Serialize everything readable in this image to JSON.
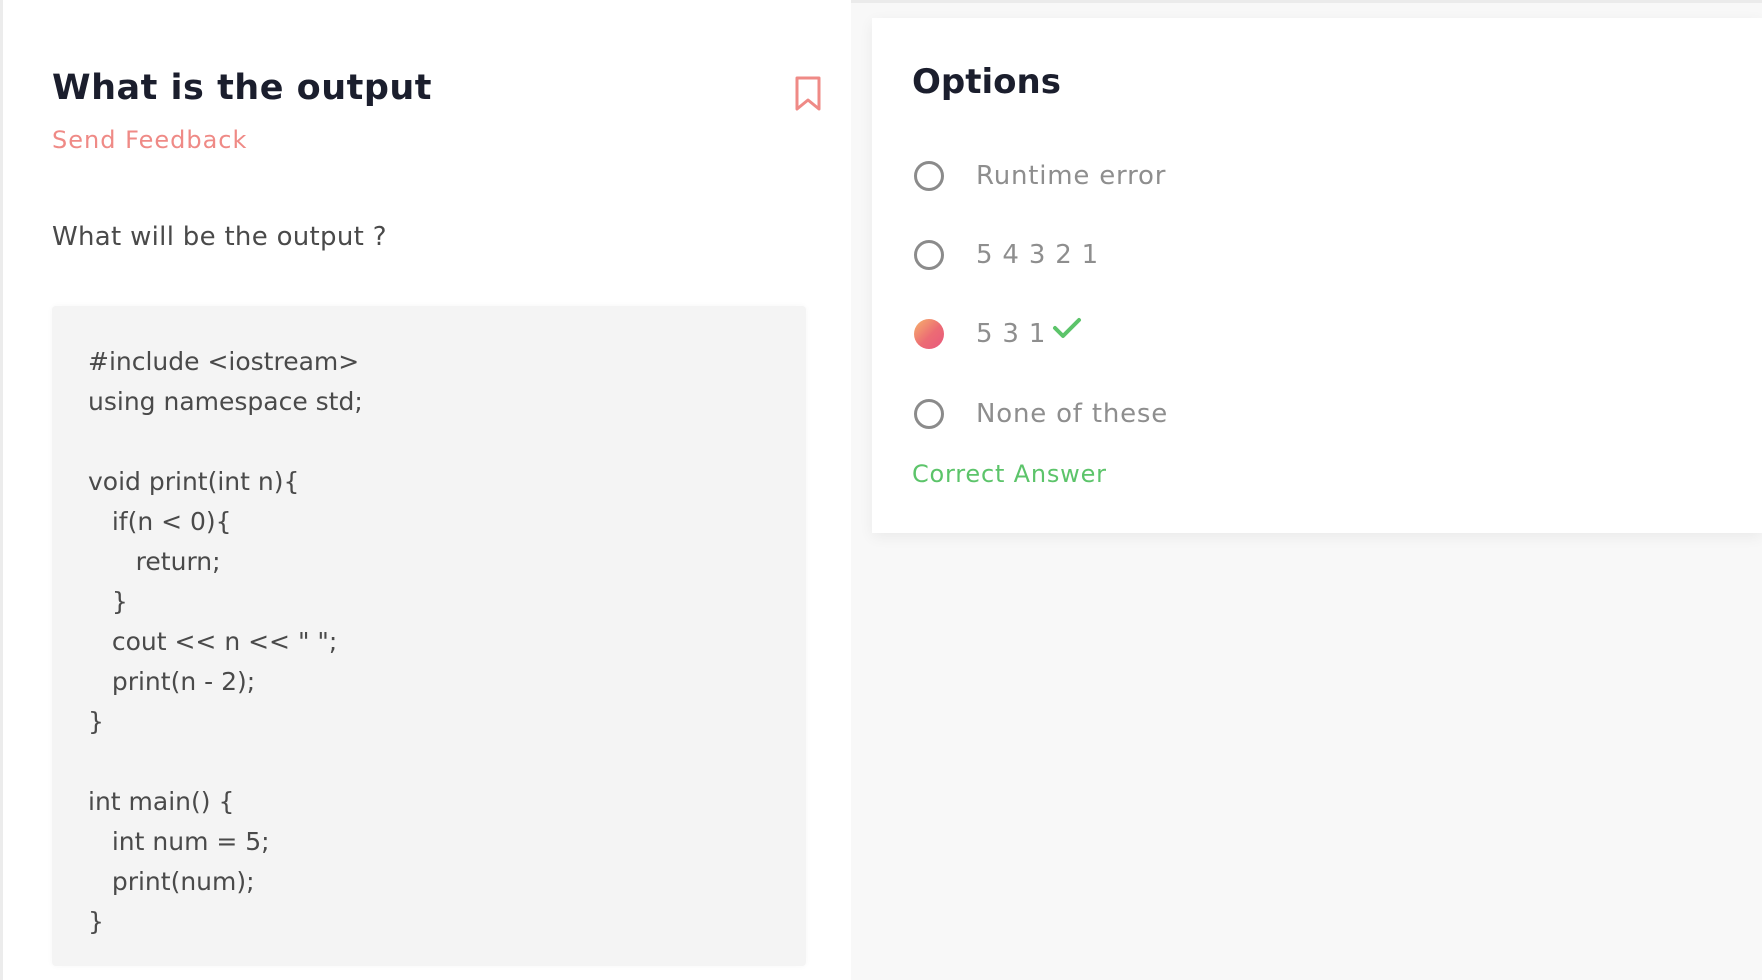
{
  "question": {
    "title": "What is the output",
    "send_feedback_label": "Send Feedback",
    "prompt": "What will be the output ?",
    "code": "#include <iostream>\nusing namespace std;\n\nvoid print(int n){\n   if(n < 0){\n      return;\n   }\n   cout << n << \" \";\n   print(n - 2);\n}\n\nint main() {\n   int num = 5;\n   print(num);\n}"
  },
  "options": {
    "title": "Options",
    "items": [
      {
        "label": "Runtime error",
        "selected": false
      },
      {
        "label": "5 4 3 2 1",
        "selected": false
      },
      {
        "label": "5 3 1",
        "selected": true,
        "correct": true
      },
      {
        "label": "None of these",
        "selected": false
      }
    ],
    "result_label": "Correct Answer"
  },
  "icons": {
    "bookmark": "bookmark-icon",
    "check": "check-icon"
  },
  "colors": {
    "accent": "#ef8a86",
    "correct": "#5cc46a",
    "title": "#1b1e2d"
  }
}
